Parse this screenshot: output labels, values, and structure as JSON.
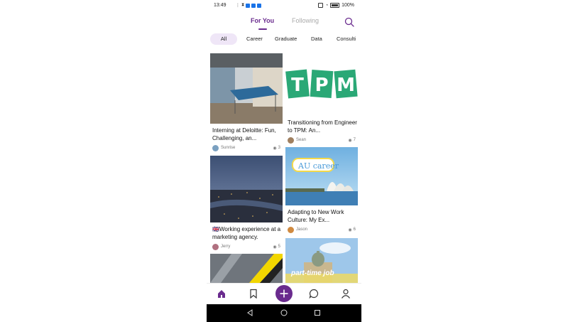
{
  "status": {
    "time": "13:49",
    "battery": "100%"
  },
  "header": {
    "tabs": [
      "For You",
      "Following"
    ]
  },
  "categories": [
    "All",
    "Career",
    "Graduate",
    "Data",
    "Consulti"
  ],
  "feed": [
    {
      "title": "Interning at Deloitte: Fun, Challenging, an...",
      "author": "Sunrise",
      "views": "3",
      "image": "office-ping-pong"
    },
    {
      "title": "Transitioning from Engineer to TPM: An...",
      "author": "Sean",
      "views": "7",
      "image": "tpm-logo",
      "image_text": "TPM"
    },
    {
      "title": "🇬🇧Working experience at a marketing agency.",
      "author": "Jerry",
      "views": "5",
      "image": "city-night"
    },
    {
      "title": "Adapting to New Work Culture: My Ex...",
      "author": "Jason",
      "views": "6",
      "image": "sydney-opera-house",
      "image_text": "AU career"
    },
    {
      "title": "",
      "author": "",
      "views": "",
      "image": "escalator"
    },
    {
      "title": "",
      "author": "",
      "views": "",
      "image": "building-parttime",
      "image_text": "part-time job"
    }
  ],
  "colors": {
    "accent": "#6a2b8e"
  },
  "icons": {
    "nav": [
      "home-icon",
      "bookmark-icon",
      "add-icon",
      "chat-icon",
      "profile-icon"
    ],
    "system": [
      "back-icon",
      "home-circle-icon",
      "recents-icon"
    ]
  }
}
